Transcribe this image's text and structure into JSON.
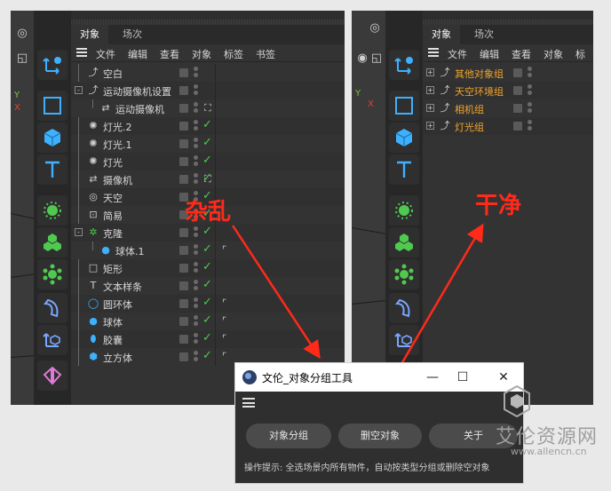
{
  "left_panel": {
    "tabs": [
      "对象",
      "场次"
    ],
    "menu": [
      "文件",
      "编辑",
      "查看",
      "对象",
      "标签",
      "书签"
    ],
    "rows": [
      {
        "label": "空白",
        "icon": "null-icon",
        "indent": 0,
        "tag": ""
      },
      {
        "label": "运动摄像机设置",
        "icon": "null-icon",
        "indent": 0,
        "tag": "",
        "expander": "-"
      },
      {
        "label": "运动摄像机",
        "icon": "motion-camera-icon",
        "indent": 1,
        "tag": "target-tag"
      },
      {
        "label": "灯光.2",
        "icon": "light-icon",
        "indent": 0,
        "tag": ""
      },
      {
        "label": "灯光.1",
        "icon": "light-icon",
        "indent": 0,
        "tag": ""
      },
      {
        "label": "灯光",
        "icon": "light-icon",
        "indent": 0,
        "tag": ""
      },
      {
        "label": "摄像机",
        "icon": "camera-icon",
        "indent": 0,
        "tag": "target-tag"
      },
      {
        "label": "天空",
        "icon": "sky-icon",
        "indent": 0,
        "tag": ""
      },
      {
        "label": "简易",
        "icon": "simple-deformer-icon",
        "indent": 0,
        "tag": ""
      },
      {
        "label": "克隆",
        "icon": "cloner-icon",
        "indent": 0,
        "tag": "",
        "expander": "-"
      },
      {
        "label": "球体.1",
        "icon": "sphere-icon",
        "indent": 1,
        "tag": "phong-tag"
      },
      {
        "label": "矩形",
        "icon": "rectangle-icon",
        "indent": 0,
        "tag": ""
      },
      {
        "label": "文本样条",
        "icon": "text-icon",
        "indent": 0,
        "tag": ""
      },
      {
        "label": "圆环体",
        "icon": "torus-icon",
        "indent": 0,
        "tag": "phong-tag"
      },
      {
        "label": "球体",
        "icon": "sphere-icon",
        "indent": 0,
        "tag": "phong-tag"
      },
      {
        "label": "胶囊",
        "icon": "capsule-icon",
        "indent": 0,
        "tag": "phong-tag"
      },
      {
        "label": "立方体",
        "icon": "cube-icon",
        "indent": 0,
        "tag": "phong-tag"
      }
    ]
  },
  "right_panel": {
    "tabs": [
      "对象",
      "场次"
    ],
    "menu": [
      "文件",
      "编辑",
      "查看",
      "对象",
      "标"
    ],
    "rows": [
      {
        "label": "其他对象组"
      },
      {
        "label": "天空环境组"
      },
      {
        "label": "相机组"
      },
      {
        "label": "灯光组"
      }
    ]
  },
  "annotations": {
    "left": "杂乱",
    "right": "干净"
  },
  "dialog": {
    "title": "文伦_对象分组工具",
    "buttons": [
      "对象分组",
      "删空对象",
      "关于"
    ],
    "hint": "操作提示: 全选场景内所有物件，自动按类型分组或删除空对象"
  },
  "watermark": {
    "brand": "艾伦资源网",
    "url": "www.allencn.cn"
  },
  "colors": {
    "accent_red": "#ff2a1a",
    "group_orange": "#f0a52e",
    "check_green": "#4fc94f"
  }
}
